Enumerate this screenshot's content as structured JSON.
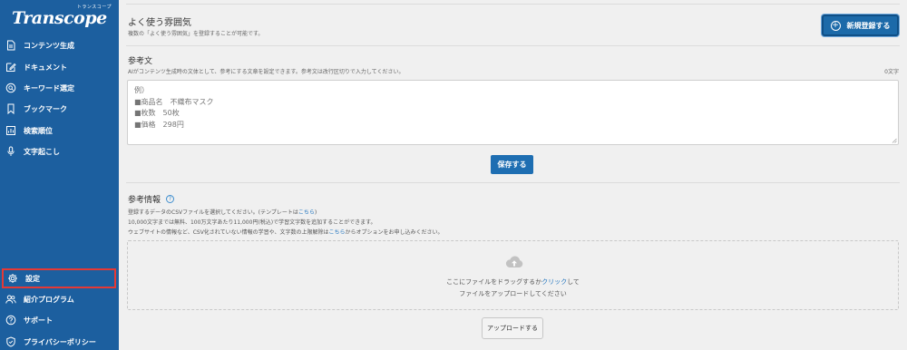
{
  "sidebar": {
    "logo_ruby": "トランスコープ",
    "logo": "Transcope",
    "items": [
      {
        "label": "コンテンツ生成",
        "icon": "document-icon"
      },
      {
        "label": "ドキュメント",
        "icon": "edit-icon"
      },
      {
        "label": "キーワード選定",
        "icon": "search-icon"
      },
      {
        "label": "ブックマーク",
        "icon": "bookmark-icon"
      },
      {
        "label": "検索順位",
        "icon": "chart-icon"
      },
      {
        "label": "文字起こし",
        "icon": "microphone-icon"
      }
    ],
    "bottom_items": [
      {
        "label": "設定",
        "icon": "gear-icon",
        "selected": true
      },
      {
        "label": "紹介プログラム",
        "icon": "users-icon"
      },
      {
        "label": "サポート",
        "icon": "help-icon"
      },
      {
        "label": "プライバシーポリシー",
        "icon": "shield-icon"
      }
    ]
  },
  "atmosphere": {
    "title": "よく使う雰囲気",
    "subtitle": "複数の「よく使う雰囲気」を登録することが可能です。",
    "new_button": "新規登録する"
  },
  "reference_text": {
    "title": "参考文",
    "subtitle": "AIがコンテンツ生成時の文体として、参考にする文章を設定できます。参考文は改行区切りで入力してください。",
    "char_count": "0文字",
    "placeholder": "例）\n■商品名　不織布マスク\n■枚数　50枚\n■価格　298円",
    "save_button": "保存する"
  },
  "reference_info": {
    "title": "参考情報",
    "line1_prefix": "登録するデータのCSVファイルを選択してください。(テンプレートは",
    "line1_link": "こちら",
    "line1_suffix": ")",
    "line2": "10,000文字までは無料、100万文字あたり11,000円(税込)で学習文字数を追加することができます。",
    "line3_prefix": "ウェブサイトの情報など、CSV化されていない情報の学習や、文字数の上限解除は",
    "line3_link": "こちら",
    "line3_suffix": "からオプションをお申し込みください。",
    "drop_prefix": "ここにファイルをドラッグするか",
    "drop_link": "クリック",
    "drop_suffix": "して",
    "drop_line2": "ファイルをアップロードしてください",
    "upload_button": "アップロードする"
  }
}
